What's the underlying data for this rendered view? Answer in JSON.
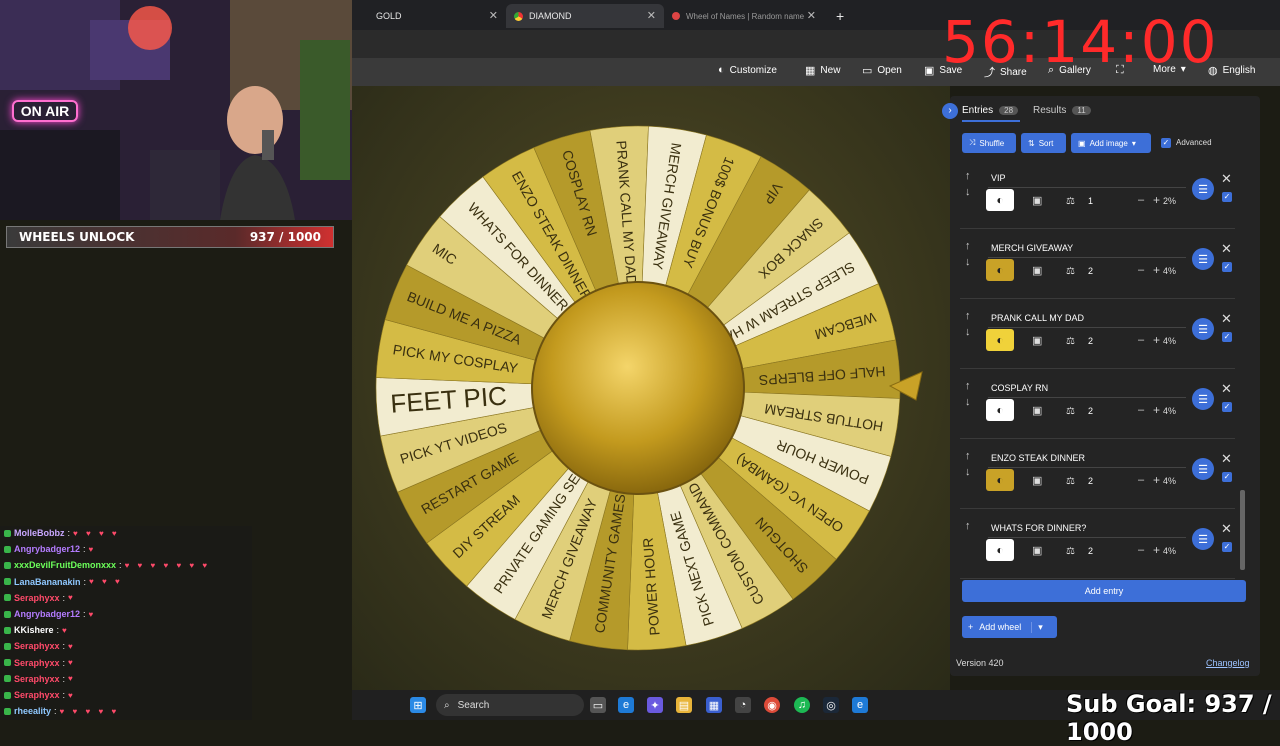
{
  "browser": {
    "tabs": [
      {
        "label": "GOLD",
        "close": "✕"
      },
      {
        "label": "DIAMOND",
        "close": "✕"
      },
      {
        "label": "Wheel of Names | Random name",
        "close": "✕"
      }
    ],
    "new_tab": "+"
  },
  "timer": "56:14:00",
  "toolbar": {
    "items": [
      {
        "icon": "palette-icon",
        "label": "Customize"
      },
      {
        "icon": "new-doc-icon",
        "label": "New"
      },
      {
        "icon": "folder-icon",
        "label": "Open"
      },
      {
        "icon": "save-icon",
        "label": "Save"
      },
      {
        "icon": "share-icon",
        "label": "Share"
      },
      {
        "icon": "search-icon",
        "label": "Gallery"
      },
      {
        "icon": "fullscreen-icon",
        "label": ""
      },
      {
        "icon": "more-icon",
        "label": "More"
      },
      {
        "icon": "globe-icon",
        "label": "English"
      }
    ]
  },
  "stream": {
    "on_air": "ON AIR",
    "unlock_label": "WHEELS UNLOCK",
    "unlock_count": "937 / 1000",
    "unlock_progress": 0.937,
    "sub_goal": "Sub Goal: 937 / 1000"
  },
  "chat": [
    {
      "user": "MolleBobbz",
      "color": "#c9a8ff",
      "hearts": "♥ ♥ ♥ ♥"
    },
    {
      "user": "Angrybadger12",
      "color": "#b47cff",
      "hearts": "♥"
    },
    {
      "user": "xxxDevilFruitDemonxxx",
      "color": "#6cff5a",
      "hearts": "♥ ♥ ♥ ♥ ♥ ♥ ♥"
    },
    {
      "user": "LanaBananakin",
      "color": "#8fc8ff",
      "hearts": "♥ ♥ ♥"
    },
    {
      "user": "Seraphyxx",
      "color": "#ff4a6a",
      "hearts": "♥"
    },
    {
      "user": "Angrybadger12",
      "color": "#b47cff",
      "hearts": "♥"
    },
    {
      "user": "KKishere",
      "color": "#ffffff",
      "hearts": "♥"
    },
    {
      "user": "Seraphyxx",
      "color": "#ff4a6a",
      "hearts": "♥"
    },
    {
      "user": "Seraphyxx",
      "color": "#ff4a6a",
      "hearts": "♥"
    },
    {
      "user": "Seraphyxx",
      "color": "#ff4a6a",
      "hearts": "♥"
    },
    {
      "user": "Seraphyxx",
      "color": "#ff4a6a",
      "hearts": "♥"
    },
    {
      "user": "rheeality",
      "color": "#8fc8ff",
      "hearts": "♥ ♥ ♥ ♥ ♥"
    }
  ],
  "wheel": {
    "colors": [
      "#b59a2a",
      "#e0cf7a",
      "#f2ecd0",
      "#d4bb45"
    ],
    "segments": [
      "VIP",
      "SNACK BOX",
      "SLEEP STREAM W HA...",
      "WEBCAM",
      "HALF OFF BLERPS",
      "HOTTUB STREAM",
      "POWER HOUR",
      "OPEN VC (GAMBA)",
      "SHOTGUN",
      "CUSTOM COMMAND",
      "PICK NEXT GAME",
      "POWER HOUR",
      "COMMUNITY GAMES",
      "MERCH GIVEAWAY",
      "PRIVATE GAMING SE...",
      "DIY STREAM",
      "RESTART GAME",
      "PICK YT VIDEOS",
      "FEET PIC",
      "PICK MY COSPLAY",
      "BUILD ME A PIZZA",
      "MIC",
      "WHATS FOR DINNER?",
      "ENZO STEAK DINNER",
      "COSPLAY RN",
      "PRANK CALL MY DAD",
      "MERCH GIVEAWAY",
      "100$ BONUS BUY"
    ],
    "accent": "#c9a227"
  },
  "panel": {
    "tab_entries": "Entries",
    "entries_count": "28",
    "tab_results": "Results",
    "results_count": "11",
    "shuffle": "Shuffle",
    "sort": "Sort",
    "add_image": "Add image",
    "advanced": "Advanced",
    "entries": [
      {
        "name": "VIP",
        "weight": "1",
        "pct": "2%",
        "swatch": "#ffffff"
      },
      {
        "name": "MERCH GIVEAWAY",
        "weight": "2",
        "pct": "4%",
        "swatch": "#c9a227"
      },
      {
        "name": "PRANK CALL MY DAD",
        "weight": "2",
        "pct": "4%",
        "swatch": "#f0d23a"
      },
      {
        "name": "COSPLAY RN",
        "weight": "2",
        "pct": "4%",
        "swatch": "#ffffff"
      },
      {
        "name": "ENZO STEAK DINNER",
        "weight": "2",
        "pct": "4%",
        "swatch": "#c9a227"
      },
      {
        "name": "WHATS FOR DINNER?",
        "weight": "2",
        "pct": "4%",
        "swatch": "#ffffff"
      }
    ],
    "add_entry": "Add entry",
    "add_wheel": "Add wheel",
    "version": "Version 420",
    "changelog": "Changelog"
  },
  "taskbar": {
    "search": "Search"
  }
}
